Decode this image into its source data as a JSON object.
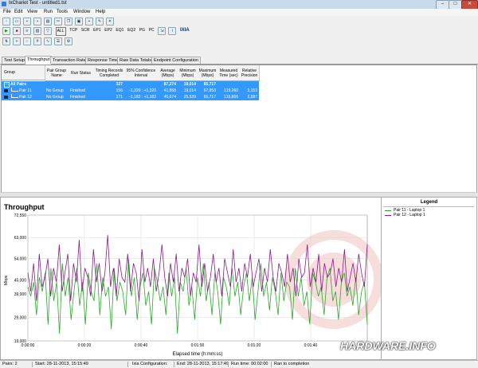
{
  "window": {
    "title": "IxChariot Test - untitled1.tst",
    "minimize": "–",
    "maximize": "□",
    "close": "✕"
  },
  "menu": [
    "File",
    "Edit",
    "View",
    "Run",
    "Tools",
    "Window",
    "Help"
  ],
  "toolbar2": {
    "labels": [
      "ALL",
      "TCP",
      "SCR",
      "EP1",
      "EP2",
      "EQ1",
      "EQ2",
      "PG",
      "PC"
    ],
    "brand": "IXIA"
  },
  "tabs": [
    "Test Setup",
    "Throughput",
    "Transaction Rate",
    "Response Time",
    "Raw Data Totals",
    "Endpoint Configuration"
  ],
  "columns": [
    "Group",
    "Pair Group Name",
    "Run Status",
    "Timing Records Completed",
    "95% Confidence Interval",
    "Average (Mbps)",
    "Minimum (Mbps)",
    "Maximum (Mbps)",
    "Measured Time (sec)",
    "Relative Precision"
  ],
  "rows": [
    {
      "name": "All Pairs",
      "group": "",
      "status": "",
      "records": "327",
      "ci": "",
      "avg": "87,274",
      "min": "19,014",
      "max": "65,717",
      "time": "",
      "prec": ""
    },
    {
      "name": "Pair 11",
      "group": "No Group",
      "status": "Finished",
      "records": "156",
      "ci": "-1,320 : +1,320",
      "avg": "41,858",
      "min": "19,014",
      "max": "67,853",
      "time": "119,260",
      "prec": "3,153"
    },
    {
      "name": "Pair 12",
      "group": "No Group",
      "status": "Finished",
      "records": "171",
      "ci": "-1,182 : +1,182",
      "avg": "45,674",
      "min": "25,539",
      "max": "65,717",
      "time": "119,806",
      "prec": "2,587"
    }
  ],
  "colors": {
    "pair11": "#2aa82a",
    "pair12": "#8a1a86",
    "selection": "#3399ff",
    "watermark": "#d0312d"
  },
  "chart_data": {
    "type": "line",
    "title": "Throughput",
    "xlabel": "Elapsed time (h:mm:ss)",
    "ylabel": "Mbps",
    "x_ticks": [
      "0:00:00",
      "0:00:20",
      "0:00:40",
      "0:01:00",
      "0:01:20",
      "0:01:40"
    ],
    "y_ticks": [
      "72,550",
      "63,000",
      "54,000",
      "45,000",
      "39,000",
      "29,000",
      "19,000"
    ],
    "ylim": [
      19,
      72.55
    ],
    "xlim": [
      0,
      120
    ],
    "grid": true,
    "legend_position": "right panel",
    "series": [
      {
        "name": "Pair 11 - Laptop 1",
        "values": [
          42,
          38,
          44,
          30,
          46,
          40,
          48,
          26,
          50,
          36,
          44,
          22,
          52,
          38,
          46,
          28,
          40,
          50,
          34,
          44,
          26,
          48,
          40,
          36,
          52,
          30,
          46,
          38,
          42,
          24,
          50,
          36,
          44,
          40,
          30,
          54,
          38,
          46,
          28,
          42,
          48,
          34,
          40,
          26,
          50,
          44,
          36,
          42,
          30,
          48,
          38,
          46,
          22,
          44,
          40,
          50,
          34,
          42,
          28,
          46,
          38,
          52,
          36,
          44,
          30,
          48,
          40,
          26,
          46,
          42,
          34,
          50,
          38,
          44,
          30,
          42,
          48,
          36,
          46,
          28,
          40,
          52,
          38,
          44,
          32,
          46,
          40,
          30,
          48,
          36,
          44,
          42,
          28,
          50,
          38,
          46,
          34,
          40,
          26,
          48,
          44,
          38,
          42,
          30,
          46,
          50,
          36,
          40,
          28,
          44,
          48,
          38,
          42,
          34,
          46,
          30,
          40,
          44,
          26
        ]
      },
      {
        "name": "Pair 12 - Laptop 1",
        "values": [
          48,
          40,
          52,
          36,
          56,
          42,
          46,
          54,
          38,
          50,
          44,
          60,
          40,
          48,
          56,
          36,
          52,
          44,
          62,
          40,
          50,
          46,
          38,
          58,
          44,
          52,
          40,
          48,
          64,
          42,
          50,
          38,
          54,
          46,
          44,
          56,
          40,
          52,
          48,
          36,
          58,
          44,
          50,
          42,
          54,
          40,
          48,
          60,
          46,
          38,
          52,
          44,
          56,
          40,
          50,
          46,
          54,
          38,
          48,
          44,
          60,
          42,
          52,
          40,
          46,
          56,
          44,
          50,
          38,
          54,
          48,
          42,
          58,
          44,
          50,
          40,
          52,
          46,
          56,
          42,
          48,
          54,
          40,
          50,
          44,
          58,
          46,
          40,
          52,
          48,
          42,
          56,
          44,
          50,
          38,
          54,
          46,
          48,
          60,
          42,
          50,
          44,
          56,
          40,
          52,
          46,
          48,
          54,
          42,
          50,
          44,
          58,
          40,
          46,
          52,
          44,
          56,
          48,
          42,
          60
        ]
      }
    ]
  },
  "legend": {
    "title": "Legend",
    "items": [
      "Pair 11 - Laptop 1",
      "Pair 12 - Laptop 1"
    ]
  },
  "watermark": "HARDWARE.INFO",
  "status": [
    "Pairs: 2",
    "Start: 28-11-2013, 15:15:49",
    "Ixia Configuration:",
    "End: 28-11-2013, 15:17:49",
    "Run time: 00:02:00",
    "Ran to completion"
  ]
}
